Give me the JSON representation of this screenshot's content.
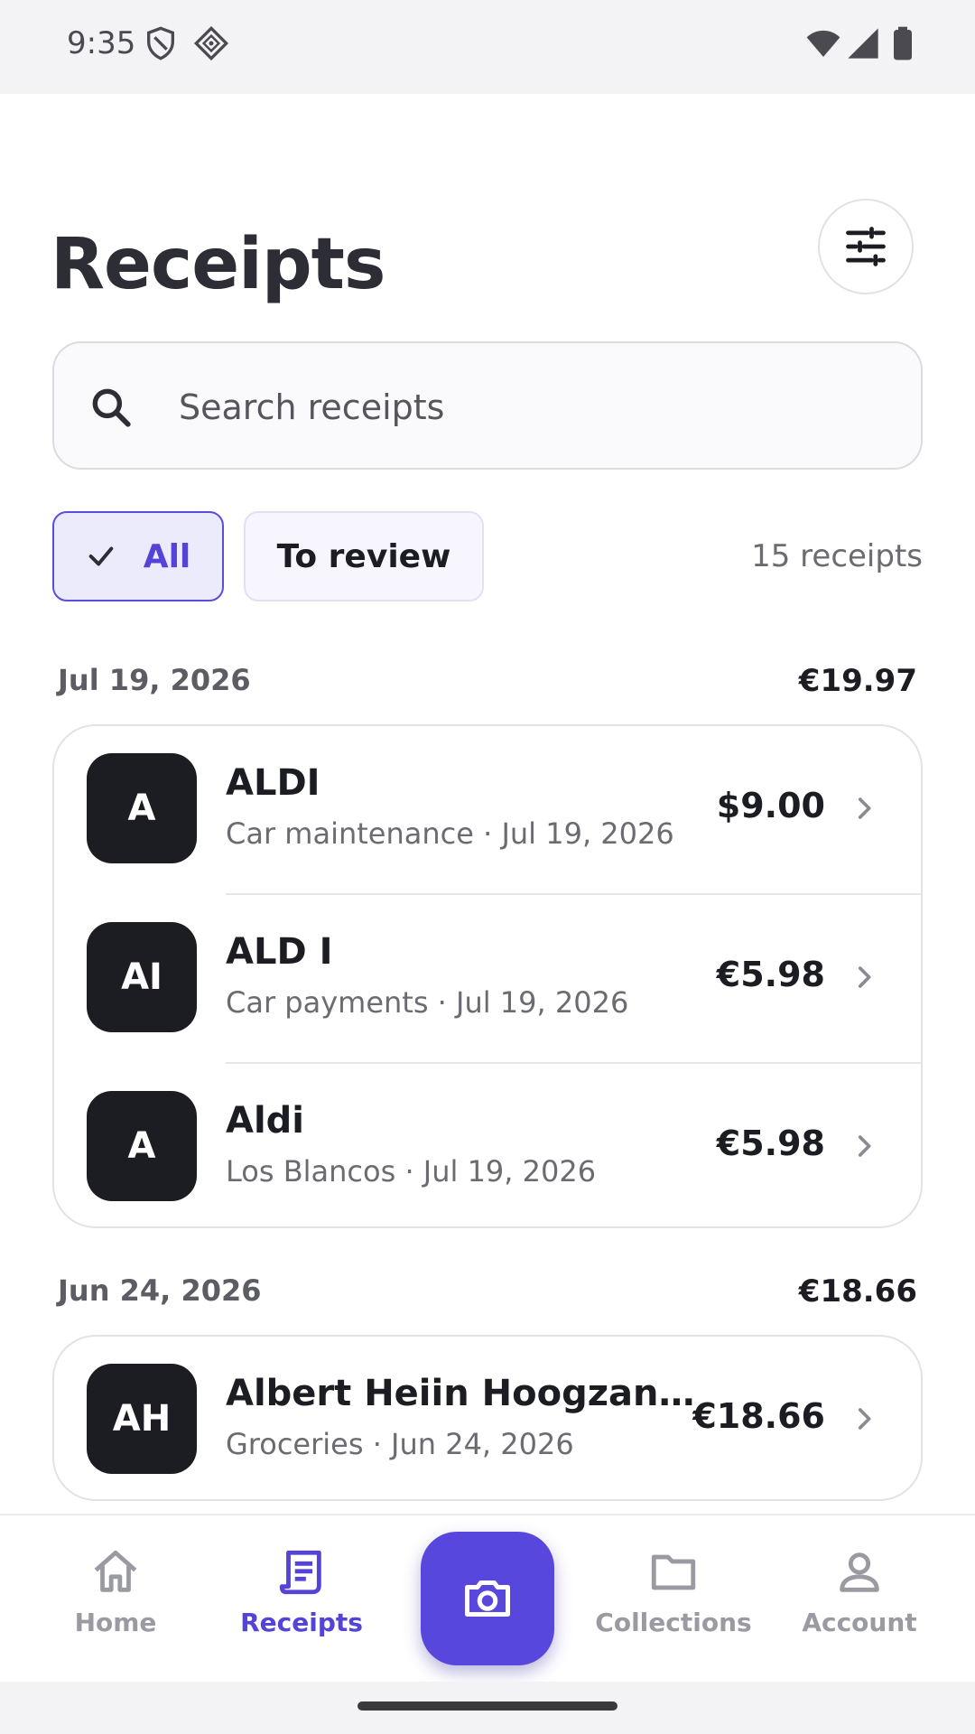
{
  "status_bar": {
    "time": "9:35",
    "icons": [
      "shield-icon",
      "vpn-diamond-icon",
      "wifi-icon",
      "signal-icon",
      "battery-icon"
    ]
  },
  "page": {
    "title": "Receipts",
    "filter_icon": "tune-sliders-icon"
  },
  "search": {
    "placeholder": "Search receipts",
    "value": ""
  },
  "filters": {
    "chips": [
      {
        "label": "All",
        "selected": true
      },
      {
        "label": "To review",
        "selected": false
      }
    ],
    "count_text": "15 receipts"
  },
  "groups": [
    {
      "date": "Jul 19, 2026",
      "total": "€19.97",
      "receipts": [
        {
          "initials": "A",
          "merchant": "ALDI",
          "meta": "Car maintenance · Jul 19, 2026",
          "amount": "$9.00"
        },
        {
          "initials": "AI",
          "merchant": "ALD I",
          "meta": "Car payments · Jul 19, 2026",
          "amount": "€5.98"
        },
        {
          "initials": "A",
          "merchant": "Aldi",
          "meta": "Los Blancos · Jul 19, 2026",
          "amount": "€5.98"
        }
      ]
    },
    {
      "date": "Jun 24, 2026",
      "total": "€18.66",
      "receipts": [
        {
          "initials": "AH",
          "merchant": "Albert Heiin Hoogzand…",
          "meta": "Groceries · Jun 24, 2026",
          "amount": "€18.66"
        }
      ]
    }
  ],
  "bottom_nav": {
    "items": [
      {
        "label": "Home",
        "icon": "home-icon",
        "active": false
      },
      {
        "label": "Receipts",
        "icon": "receipt-icon",
        "active": true
      },
      {
        "label": "Collections",
        "icon": "folder-icon",
        "active": false
      },
      {
        "label": "Account",
        "icon": "person-icon",
        "active": false
      }
    ],
    "fab_icon": "camera-icon"
  },
  "colors": {
    "accent": "#5747dc",
    "accent_text": "#5343d6",
    "chip_selected_bg": "#ecebfb",
    "avatar_bg": "#1c1d22"
  }
}
